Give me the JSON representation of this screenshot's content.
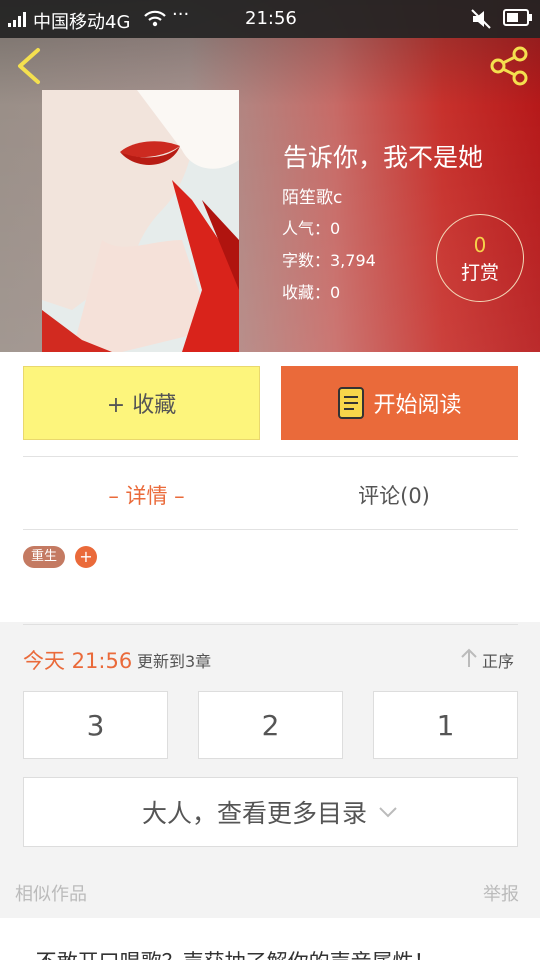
{
  "status_bar": {
    "carrier": "中国移动4G",
    "more_dots": "···",
    "time": "21:56"
  },
  "book": {
    "title": "告诉你，我不是她",
    "author": "陌笙歌c",
    "popularity": "人气：0",
    "word_count": "字数：3,794",
    "favorites": "收藏：0",
    "tip_count": "0",
    "tip_label": "打赏"
  },
  "actions": {
    "collect_label": "+ 收藏",
    "read_label": "开始阅读"
  },
  "tabs": {
    "details": "– 详情 –",
    "comments": "评论(0)"
  },
  "tags": {
    "items": [
      "重生"
    ],
    "add_symbol": "+"
  },
  "updates": {
    "date": "今天 21:56",
    "text": "更新到3章",
    "sort_label": "正序"
  },
  "chapters": [
    "3",
    "2",
    "1"
  ],
  "more_catalog": "大人，查看更多目录",
  "footer": {
    "similar": "相似作品",
    "report": "举报"
  },
  "preview_text": "‑不敢开口唱歌？声获抽了解你的声音属性！",
  "colors": {
    "accent": "#ea6a3a",
    "collect_bg": "#fdf57c",
    "tag_bg": "#c47a62"
  }
}
